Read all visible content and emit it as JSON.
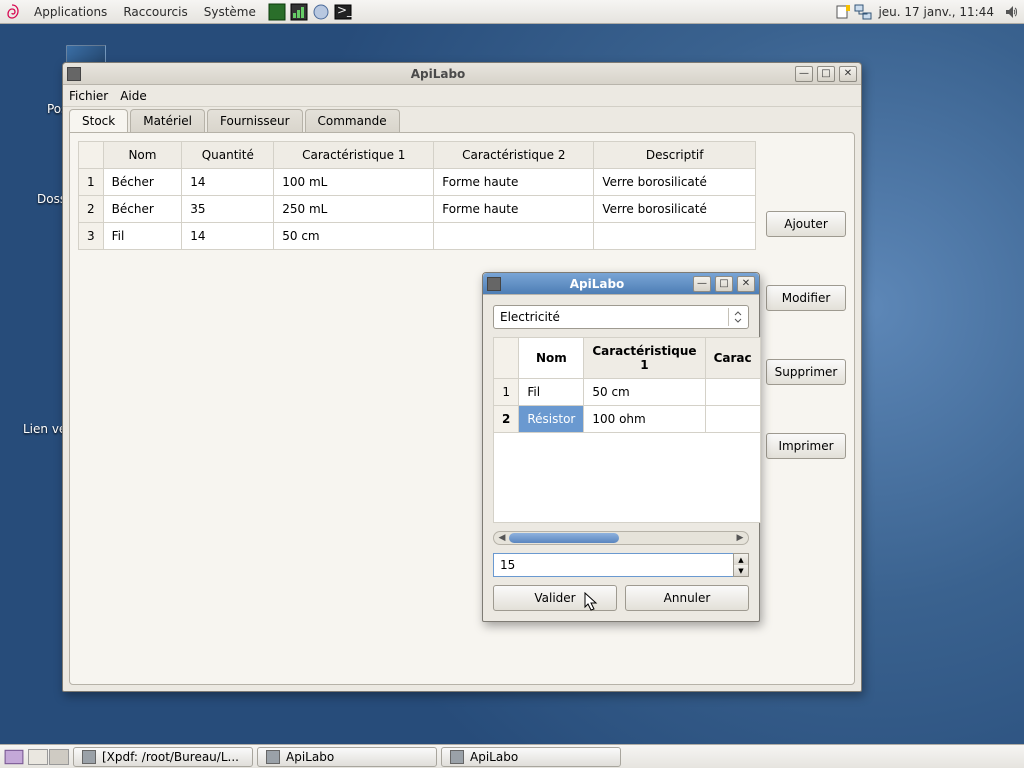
{
  "panel": {
    "top_menus": [
      "Applications",
      "Raccourcis",
      "Système"
    ],
    "clock": "jeu. 17 janv., 11:44"
  },
  "desktop_icons": {
    "i1": "Pos",
    "i2": "Doss",
    "i3": "Lien ve"
  },
  "main_window": {
    "title": "ApiLabo",
    "menu": {
      "fichier": "Fichier",
      "aide": "Aide"
    },
    "tabs": {
      "stock": "Stock",
      "materiel": "Matériel",
      "fournisseur": "Fournisseur",
      "commande": "Commande"
    },
    "headers": {
      "nom": "Nom",
      "quantite": "Quantité",
      "c1": "Caractéristique 1",
      "c2": "Caractéristique 2",
      "desc": "Descriptif"
    },
    "rows": [
      {
        "n": "1",
        "nom": "Bécher",
        "qte": "14",
        "c1": "100 mL",
        "c2": "Forme haute",
        "desc": "Verre borosilicaté"
      },
      {
        "n": "2",
        "nom": "Bécher",
        "qte": "35",
        "c1": "250 mL",
        "c2": "Forme haute",
        "desc": "Verre borosilicaté"
      },
      {
        "n": "3",
        "nom": "Fil",
        "qte": "14",
        "c1": "50 cm",
        "c2": "",
        "desc": ""
      }
    ],
    "buttons": {
      "ajouter": "Ajouter",
      "modifier": "Modifier",
      "supprimer": "Supprimer",
      "imprimer": "Imprimer"
    }
  },
  "dialog": {
    "title": "ApiLabo",
    "combo": "Electricité",
    "headers": {
      "nom": "Nom",
      "c1": "Caractéristique 1",
      "c2": "Carac"
    },
    "rows": [
      {
        "n": "1",
        "nom": "Fil",
        "c1": "50 cm"
      },
      {
        "n": "2",
        "nom": "Résistor",
        "c1": "100 ohm"
      }
    ],
    "spinner_value": "15",
    "buttons": {
      "valider": "Valider",
      "annuler": "Annuler"
    }
  },
  "taskbar": {
    "t1": "[Xpdf: /root/Bureau/L...",
    "t2": "ApiLabo",
    "t3": "ApiLabo"
  }
}
